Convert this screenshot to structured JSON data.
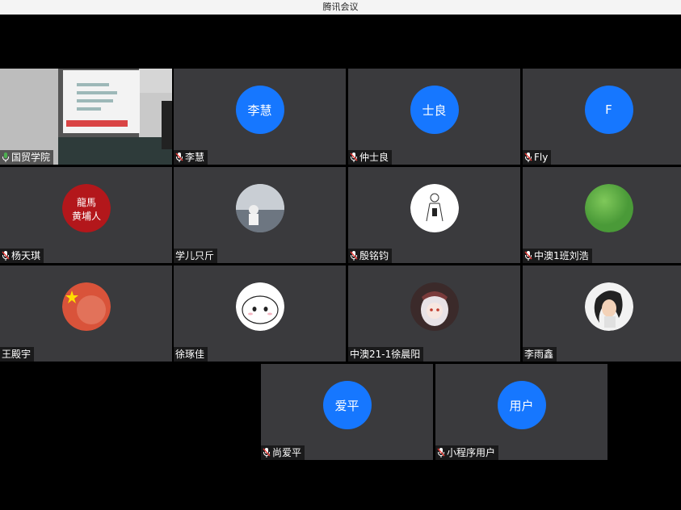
{
  "window": {
    "title": "腾讯会议"
  },
  "colors": {
    "avatar_blue": "#1677ff",
    "tile_bg": "#3a3a3d",
    "mic_on": "#4caf50",
    "mic_muted": "#e53935"
  },
  "participants": [
    {
      "name": "国贸学院",
      "avatar_type": "video",
      "mic": "on"
    },
    {
      "name": "李慧",
      "avatar_text": "李慧",
      "avatar_type": "initials",
      "mic": "muted"
    },
    {
      "name": "仲士良",
      "avatar_text": "士良",
      "avatar_type": "initials",
      "mic": "muted"
    },
    {
      "name": "Fly",
      "avatar_text": "F",
      "avatar_type": "initials",
      "mic": "muted"
    },
    {
      "name": "杨天琪",
      "avatar_type": "image",
      "image": "calligraphy-avatar",
      "image_text": "龍馬 黄埔人",
      "mic": "muted"
    },
    {
      "name": "学儿只斤",
      "avatar_type": "image",
      "image": "photo-avatar",
      "mic": "none"
    },
    {
      "name": "殷铭钧",
      "avatar_type": "image",
      "image": "sketch-avatar",
      "mic": "muted"
    },
    {
      "name": "中澳1班刘浩",
      "avatar_type": "image",
      "image": "green-avatar",
      "mic": "muted"
    },
    {
      "name": "王殿宇",
      "avatar_type": "image",
      "image": "flag-avatar",
      "mic": "none"
    },
    {
      "name": "徐琢佳",
      "avatar_type": "image",
      "image": "cartoon-blob-avatar",
      "mic": "none"
    },
    {
      "name": "中澳21-1徐晨阳",
      "avatar_type": "image",
      "image": "anime-girl-avatar",
      "mic": "none"
    },
    {
      "name": "李雨鑫",
      "avatar_type": "image",
      "image": "illustration-avatar",
      "mic": "none"
    },
    {
      "name": "尚爱平",
      "avatar_text": "爱平",
      "avatar_type": "initials",
      "mic": "muted"
    },
    {
      "name": "小程序用户",
      "avatar_text": "用户",
      "avatar_type": "initials",
      "mic": "muted"
    }
  ]
}
